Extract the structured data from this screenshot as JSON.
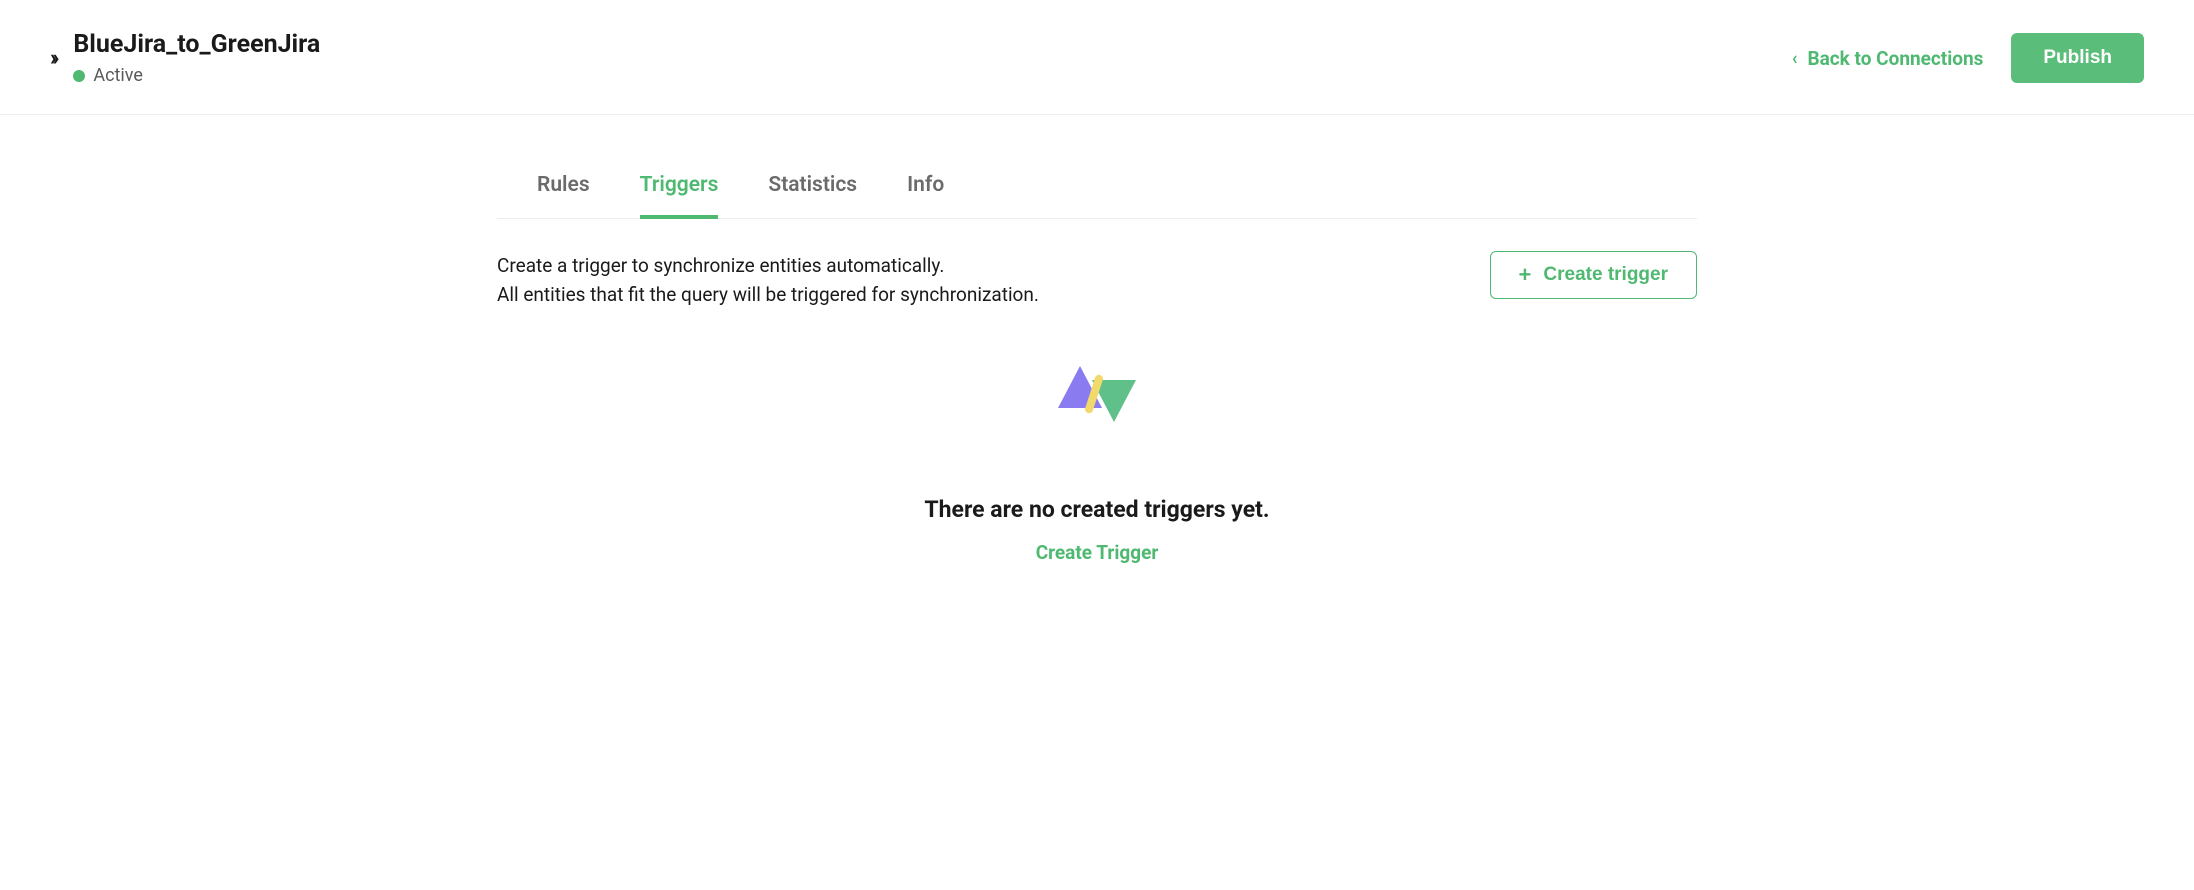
{
  "header": {
    "title": "BlueJira_to_GreenJira",
    "status_label": "Active",
    "back_link_label": "Back to Connections",
    "publish_label": "Publish"
  },
  "tabs": [
    {
      "label": "Rules",
      "active": false
    },
    {
      "label": "Triggers",
      "active": true
    },
    {
      "label": "Statistics",
      "active": false
    },
    {
      "label": "Info",
      "active": false
    }
  ],
  "description": {
    "line1": "Create a trigger to synchronize entities automatically.",
    "line2": "All entities that fit the query will be triggered for synchronization."
  },
  "create_trigger_button": "Create trigger",
  "empty_state": {
    "title": "There are no created triggers yet.",
    "link": "Create Trigger"
  }
}
